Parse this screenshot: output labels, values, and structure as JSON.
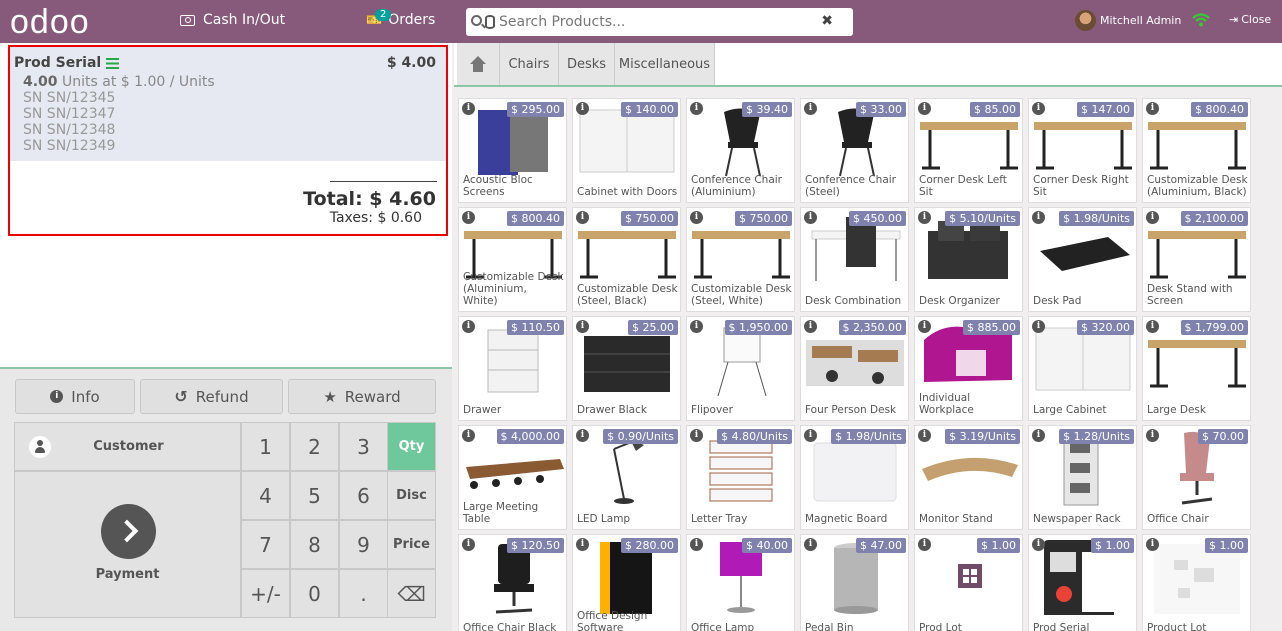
{
  "header": {
    "logo": "odoo",
    "cash_label": "Cash In/Out",
    "orders_label": "Orders",
    "orders_count": "2",
    "search_placeholder": "Search Products...",
    "clear_glyph": "✖",
    "user_name": "Mitchell Admin",
    "close_label": "Close",
    "colors": {
      "topbar": "#875a7b",
      "accent": "#6ec89b",
      "price_badge": "#7f82ac"
    }
  },
  "order": {
    "line": {
      "name": "Prod Serial",
      "price": "$ 4.00",
      "qty": "4.00",
      "unit_text": "Units at $ 1.00 / Units",
      "serials": [
        "SN SN/12345",
        "SN SN/12347",
        "SN SN/12348",
        "SN SN/12349"
      ]
    },
    "total": "Total: $ 4.60",
    "taxes": "Taxes: $ 0.60"
  },
  "controls": {
    "info_label": "Info",
    "refund_label": "Refund",
    "reward_label": "Reward",
    "customer_label": "Customer",
    "payment_label": "Payment",
    "keys": [
      "1",
      "2",
      "3",
      "4",
      "5",
      "6",
      "7",
      "8",
      "9",
      "+/-",
      "0",
      "."
    ],
    "modes": [
      "Qty",
      "Disc",
      "Price"
    ],
    "backspace": "⌫"
  },
  "categories": [
    "Chairs",
    "Desks",
    "Miscellaneous"
  ],
  "products": [
    {
      "name": "Acoustic Bloc Screens",
      "price": "$ 295.00",
      "icon": "acoustic-screen"
    },
    {
      "name": "Cabinet with Doors",
      "price": "$ 140.00",
      "icon": "cabinet"
    },
    {
      "name": "Conference Chair (Aluminium)",
      "price": "$ 39.40",
      "icon": "chair"
    },
    {
      "name": "Conference Chair (Steel)",
      "price": "$ 33.00",
      "icon": "chair"
    },
    {
      "name": "Corner Desk Left Sit",
      "price": "$ 85.00",
      "icon": "desk"
    },
    {
      "name": "Corner Desk Right Sit",
      "price": "$ 147.00",
      "icon": "desk"
    },
    {
      "name": "Customizable Desk (Aluminium, Black)",
      "price": "$ 800.40",
      "icon": "desk"
    },
    {
      "name": "Customizable Desk (Aluminium, White)",
      "price": "$ 800.40",
      "icon": "desk"
    },
    {
      "name": "Customizable Desk (Steel, Black)",
      "price": "$ 750.00",
      "icon": "desk"
    },
    {
      "name": "Customizable Desk (Steel, White)",
      "price": "$ 750.00",
      "icon": "desk"
    },
    {
      "name": "Desk Combination",
      "price": "$ 450.00",
      "icon": "desk-combo"
    },
    {
      "name": "Desk Organizer",
      "price": "$ 5.10/Units",
      "icon": "organizer"
    },
    {
      "name": "Desk Pad",
      "price": "$ 1.98/Units",
      "icon": "pad"
    },
    {
      "name": "Desk Stand with Screen",
      "price": "$ 2,100.00",
      "icon": "desk"
    },
    {
      "name": "Drawer",
      "price": "$ 110.50",
      "icon": "drawer"
    },
    {
      "name": "Drawer Black",
      "price": "$ 25.00",
      "icon": "drawer-black"
    },
    {
      "name": "Flipover",
      "price": "$ 1,950.00",
      "icon": "flipover"
    },
    {
      "name": "Four Person Desk",
      "price": "$ 2,350.00",
      "icon": "office"
    },
    {
      "name": "Individual Workplace",
      "price": "$ 885.00",
      "icon": "workplace"
    },
    {
      "name": "Large Cabinet",
      "price": "$ 320.00",
      "icon": "cabinet"
    },
    {
      "name": "Large Desk",
      "price": "$ 1,799.00",
      "icon": "desk"
    },
    {
      "name": "Large Meeting Table",
      "price": "$ 4,000.00",
      "icon": "meeting-table"
    },
    {
      "name": "LED Lamp",
      "price": "$ 0.90/Units",
      "icon": "lamp"
    },
    {
      "name": "Letter Tray",
      "price": "$ 4.80/Units",
      "icon": "tray"
    },
    {
      "name": "Magnetic Board",
      "price": "$ 1.98/Units",
      "icon": "board"
    },
    {
      "name": "Monitor Stand",
      "price": "$ 3.19/Units",
      "icon": "stand"
    },
    {
      "name": "Newspaper Rack",
      "price": "$ 1.28/Units",
      "icon": "rack"
    },
    {
      "name": "Office Chair",
      "price": "$ 70.00",
      "icon": "office-chair"
    },
    {
      "name": "Office Chair Black",
      "price": "$ 120.50",
      "icon": "office-chair-black"
    },
    {
      "name": "Office Design Software",
      "price": "$ 280.00",
      "icon": "software-box"
    },
    {
      "name": "Office Lamp",
      "price": "$ 40.00",
      "icon": "office-lamp"
    },
    {
      "name": "Pedal Bin",
      "price": "$ 47.00",
      "icon": "bin"
    },
    {
      "name": "Prod Lot",
      "price": "$ 1.00",
      "icon": "lot"
    },
    {
      "name": "Prod Serial",
      "price": "$ 1.00",
      "icon": "phone"
    },
    {
      "name": "Product Lot",
      "price": "$ 1.00",
      "icon": "sketch"
    }
  ]
}
